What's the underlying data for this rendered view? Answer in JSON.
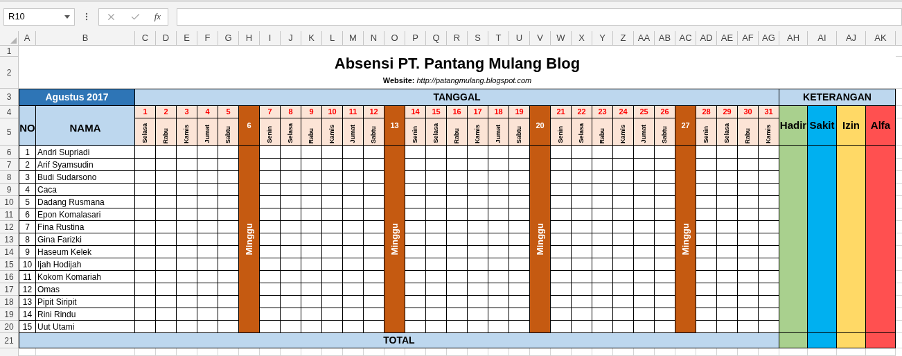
{
  "formula_bar": {
    "name_box": "R10",
    "function_label": "fx"
  },
  "column_headers": [
    "A",
    "B",
    "C",
    "D",
    "E",
    "F",
    "G",
    "H",
    "I",
    "J",
    "K",
    "L",
    "M",
    "N",
    "O",
    "P",
    "Q",
    "R",
    "S",
    "T",
    "U",
    "V",
    "W",
    "X",
    "Y",
    "Z",
    "AA",
    "AB",
    "AC",
    "AD",
    "AE",
    "AF",
    "AG",
    "AH",
    "AI",
    "AJ",
    "AK"
  ],
  "row_headers": [
    "1",
    "2",
    "3",
    "4",
    "5",
    "6",
    "7",
    "8",
    "9",
    "10",
    "11",
    "12",
    "13",
    "14",
    "15",
    "16",
    "17",
    "18",
    "19",
    "20",
    "21"
  ],
  "title": "Absensi PT. Pantang Mulang Blog",
  "website": "**Website:** *http://patangmulang.blogspot.com*",
  "month": "Agustus 2017",
  "date_header": "TANGGAL",
  "notes_header": "KETERANGAN",
  "no_header": "NO",
  "name_header": "NAMA",
  "days": [
    {
      "date": "1",
      "day": "Selasa",
      "kind": "weekday"
    },
    {
      "date": "2",
      "day": "Rabu",
      "kind": "weekday"
    },
    {
      "date": "3",
      "day": "Kamis",
      "kind": "weekday"
    },
    {
      "date": "4",
      "day": "Jumat",
      "kind": "weekday"
    },
    {
      "date": "5",
      "day": "Sabtu",
      "kind": "weekday"
    },
    {
      "date": "6",
      "day": "Minggu",
      "kind": "sunday"
    },
    {
      "date": "7",
      "day": "Senin",
      "kind": "weekday"
    },
    {
      "date": "8",
      "day": "Selasa",
      "kind": "weekday"
    },
    {
      "date": "9",
      "day": "Rabu",
      "kind": "weekday"
    },
    {
      "date": "10",
      "day": "Kamis",
      "kind": "weekday"
    },
    {
      "date": "11",
      "day": "Jumat",
      "kind": "weekday"
    },
    {
      "date": "12",
      "day": "Sabtu",
      "kind": "weekday"
    },
    {
      "date": "13",
      "day": "Minggu",
      "kind": "sunday"
    },
    {
      "date": "14",
      "day": "Senin",
      "kind": "weekday"
    },
    {
      "date": "15",
      "day": "Selasa",
      "kind": "weekday"
    },
    {
      "date": "16",
      "day": "Rabu",
      "kind": "weekday"
    },
    {
      "date": "17",
      "day": "Kamis",
      "kind": "weekday"
    },
    {
      "date": "18",
      "day": "Jumat",
      "kind": "weekday"
    },
    {
      "date": "19",
      "day": "Sabtu",
      "kind": "weekday"
    },
    {
      "date": "20",
      "day": "Minggu",
      "kind": "sunday"
    },
    {
      "date": "21",
      "day": "Senin",
      "kind": "weekday"
    },
    {
      "date": "22",
      "day": "Selasa",
      "kind": "weekday"
    },
    {
      "date": "23",
      "day": "Rabu",
      "kind": "weekday"
    },
    {
      "date": "24",
      "day": "Kamis",
      "kind": "weekday"
    },
    {
      "date": "25",
      "day": "Jumat",
      "kind": "weekday"
    },
    {
      "date": "26",
      "day": "Sabtu",
      "kind": "weekday"
    },
    {
      "date": "27",
      "day": "Minggu",
      "kind": "sunday"
    },
    {
      "date": "28",
      "day": "Senin",
      "kind": "weekday"
    },
    {
      "date": "29",
      "day": "Selasa",
      "kind": "weekday"
    },
    {
      "date": "30",
      "day": "Rabu",
      "kind": "weekday"
    },
    {
      "date": "31",
      "day": "Kamis",
      "kind": "weekday"
    }
  ],
  "notes": [
    {
      "label": "Hadir",
      "color": "#a9d08e"
    },
    {
      "label": "Sakit",
      "color": "#00b0f0"
    },
    {
      "label": "Izin",
      "color": "#ffd966"
    },
    {
      "label": "Alfa",
      "color": "#ff5050"
    }
  ],
  "employees": [
    {
      "no": "1",
      "name": "Andri Supriadi"
    },
    {
      "no": "2",
      "name": "Arif Syamsudin"
    },
    {
      "no": "3",
      "name": "Budi Sudarsono"
    },
    {
      "no": "4",
      "name": "Caca"
    },
    {
      "no": "5",
      "name": "Dadang Rusmana"
    },
    {
      "no": "6",
      "name": "Epon Komalasari"
    },
    {
      "no": "7",
      "name": "Fina Rustina"
    },
    {
      "no": "8",
      "name": "Gina Farizki"
    },
    {
      "no": "9",
      "name": "Haseum Kelek"
    },
    {
      "no": "10",
      "name": "Ijah Hodijah"
    },
    {
      "no": "11",
      "name": "Kokom Komariah"
    },
    {
      "no": "12",
      "name": "Omas"
    },
    {
      "no": "13",
      "name": "Pipit Siripit"
    },
    {
      "no": "14",
      "name": "Rini Rindu"
    },
    {
      "no": "15",
      "name": "Uut Utami"
    }
  ],
  "total_label": "TOTAL"
}
